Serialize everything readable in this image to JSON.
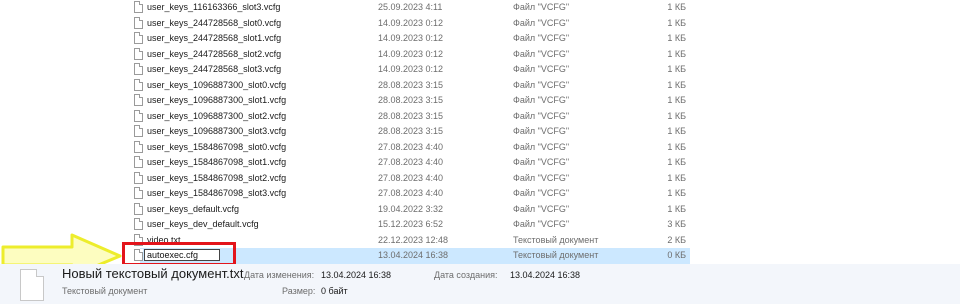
{
  "files": [
    {
      "name": "user_keys_116163366_slot3.vcfg",
      "date": "25.09.2023 4:11",
      "type": "Файл \"VCFG\"",
      "size": "1 КБ"
    },
    {
      "name": "user_keys_244728568_slot0.vcfg",
      "date": "14.09.2023 0:12",
      "type": "Файл \"VCFG\"",
      "size": "1 КБ"
    },
    {
      "name": "user_keys_244728568_slot1.vcfg",
      "date": "14.09.2023 0:12",
      "type": "Файл \"VCFG\"",
      "size": "1 КБ"
    },
    {
      "name": "user_keys_244728568_slot2.vcfg",
      "date": "14.09.2023 0:12",
      "type": "Файл \"VCFG\"",
      "size": "1 КБ"
    },
    {
      "name": "user_keys_244728568_slot3.vcfg",
      "date": "14.09.2023 0:12",
      "type": "Файл \"VCFG\"",
      "size": "1 КБ"
    },
    {
      "name": "user_keys_1096887300_slot0.vcfg",
      "date": "28.08.2023 3:15",
      "type": "Файл \"VCFG\"",
      "size": "1 КБ"
    },
    {
      "name": "user_keys_1096887300_slot1.vcfg",
      "date": "28.08.2023 3:15",
      "type": "Файл \"VCFG\"",
      "size": "1 КБ"
    },
    {
      "name": "user_keys_1096887300_slot2.vcfg",
      "date": "28.08.2023 3:15",
      "type": "Файл \"VCFG\"",
      "size": "1 КБ"
    },
    {
      "name": "user_keys_1096887300_slot3.vcfg",
      "date": "28.08.2023 3:15",
      "type": "Файл \"VCFG\"",
      "size": "1 КБ"
    },
    {
      "name": "user_keys_1584867098_slot0.vcfg",
      "date": "27.08.2023 4:40",
      "type": "Файл \"VCFG\"",
      "size": "1 КБ"
    },
    {
      "name": "user_keys_1584867098_slot1.vcfg",
      "date": "27.08.2023 4:40",
      "type": "Файл \"VCFG\"",
      "size": "1 КБ"
    },
    {
      "name": "user_keys_1584867098_slot2.vcfg",
      "date": "27.08.2023 4:40",
      "type": "Файл \"VCFG\"",
      "size": "1 КБ"
    },
    {
      "name": "user_keys_1584867098_slot3.vcfg",
      "date": "27.08.2023 4:40",
      "type": "Файл \"VCFG\"",
      "size": "1 КБ"
    },
    {
      "name": "user_keys_default.vcfg",
      "date": "19.04.2022 3:32",
      "type": "Файл \"VCFG\"",
      "size": "1 КБ"
    },
    {
      "name": "user_keys_dev_default.vcfg",
      "date": "15.12.2023 6:52",
      "type": "Файл \"VCFG\"",
      "size": "3 КБ"
    },
    {
      "name": "video.txt",
      "date": "22.12.2023 12:48",
      "type": "Текстовый документ",
      "size": "2 КБ"
    }
  ],
  "renaming": {
    "value": "autoexec.cfg",
    "date": "13.04.2024 16:38",
    "type": "Текстовый документ",
    "size": "0 КБ"
  },
  "details": {
    "filename": "Новый текстовый документ.txt",
    "filetype": "Текстовый документ",
    "modified_label": "Дата изменения:",
    "modified_value": "13.04.2024 16:38",
    "created_label": "Дата создания:",
    "created_value": "13.04.2024 16:38",
    "size_label": "Размер:",
    "size_value": "0 байт"
  },
  "annotation": {
    "arrow_color": "#f5f542",
    "box_color": "#e3141b"
  }
}
